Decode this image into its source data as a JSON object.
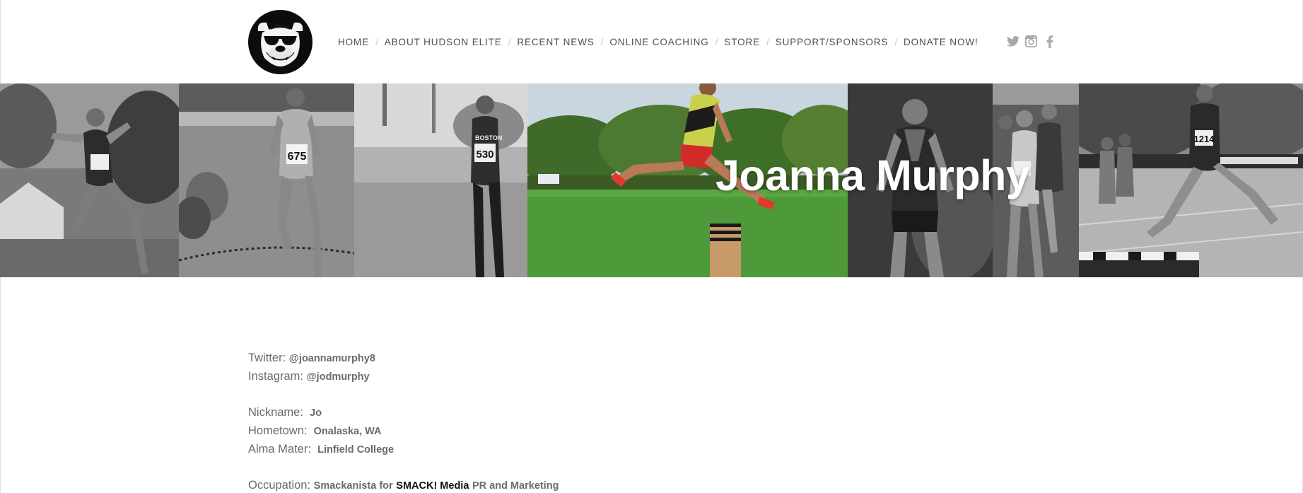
{
  "header": {
    "nav": [
      {
        "label": "HOME"
      },
      {
        "label": "ABOUT HUDSON ELITE"
      },
      {
        "label": "RECENT NEWS"
      },
      {
        "label": "ONLINE COACHING"
      },
      {
        "label": "STORE"
      },
      {
        "label": "SUPPORT/SPONSORS"
      },
      {
        "label": "DONATE NOW!"
      }
    ],
    "nav_separator": "/",
    "social": [
      {
        "icon": "twitter-icon"
      },
      {
        "icon": "instagram-icon"
      },
      {
        "icon": "facebook-icon"
      }
    ],
    "logo_icon": "bulldog-logo-icon"
  },
  "banner": {
    "title": "Joanna Murphy",
    "bib_numbers": [
      "675",
      "530",
      "1214"
    ],
    "jersey_text": "BOSTON"
  },
  "bio": {
    "twitter": {
      "label": "Twitter:",
      "handle": "@joannamurphy8"
    },
    "instagram": {
      "label": "Instagram:",
      "handle": "@jodmurphy"
    },
    "nickname": {
      "label": "Nickname:",
      "value": "Jo"
    },
    "hometown": {
      "label": "Hometown:",
      "value": "Onalaska, WA"
    },
    "alma_mater": {
      "label": "Alma Mater:",
      "value": "Linfield College"
    },
    "occupation": {
      "label": "Occupation:",
      "prefix": "Smackanista for",
      "company": "SMACK! Media",
      "suffix": "PR and Marketing"
    }
  },
  "colors": {
    "nav_text": "#4e4e4e",
    "nav_separator": "#c4c4c4",
    "social_icon": "#a8a8a8",
    "body_text": "#6b6b6b",
    "strong_text": "#111111",
    "title_text": "#ffffff"
  }
}
